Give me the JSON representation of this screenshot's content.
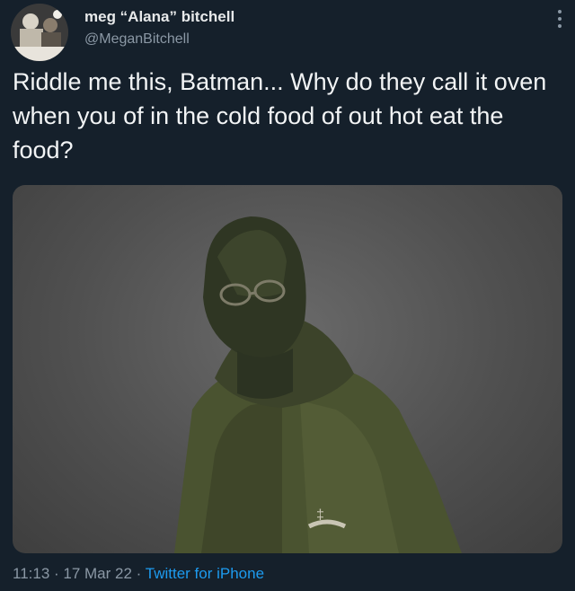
{
  "tweet": {
    "author_name": "meg “Alana” bitchell",
    "author_handle": "@MeganBitchell",
    "text": "Riddle me this, Batman... Why do they call it oven when you of in the cold food of out hot eat the food?",
    "time": "11:13",
    "separator": " · ",
    "date": "17 Mar 22",
    "source": "Twitter for iPhone"
  },
  "icons": {
    "more": "more-options-icon"
  }
}
